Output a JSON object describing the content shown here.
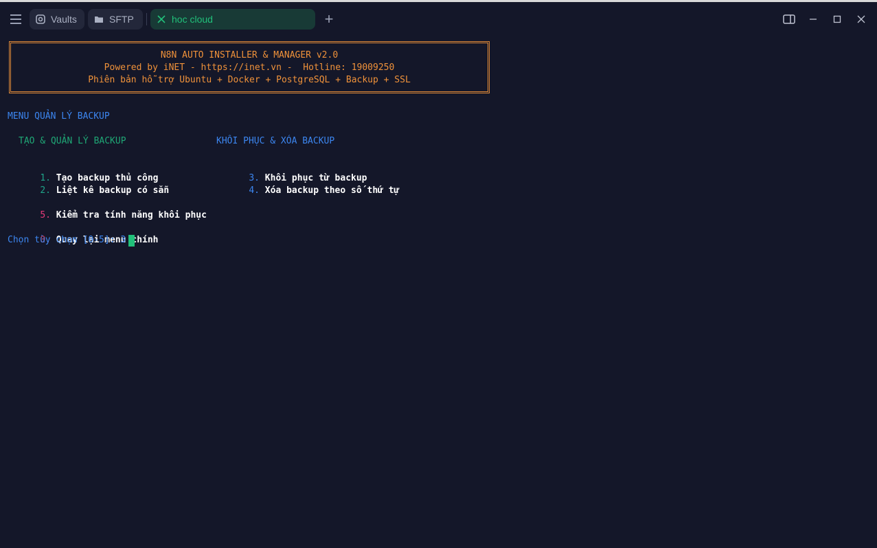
{
  "tabs": [
    {
      "label": "Vaults",
      "icon": "vault-icon"
    },
    {
      "label": "SFTP",
      "icon": "folder-icon"
    },
    {
      "label": "hoc cloud",
      "icon": "close-icon",
      "active": true
    }
  ],
  "banner": {
    "line1": "N8N AUTO INSTALLER & MANAGER v2.0",
    "line2": "Powered by iNET - https://inet.vn -  Hotline: 19009250",
    "line3": "Phiên bản hỗ trợ Ubuntu + Docker + PostgreSQL + Backup + SSL"
  },
  "menu": {
    "title": "MENU QUẢN LÝ BACKUP",
    "section_left": "TẠO & QUẢN LÝ BACKUP",
    "section_right": "KHÔI PHỤC & XÓA BACKUP",
    "options": [
      {
        "num": "1.",
        "label": "Tạo backup thủ công"
      },
      {
        "num": "2.",
        "label": "Liệt kê backup có sẵn"
      },
      {
        "num": "3.",
        "label": "Khôi phục từ backup"
      },
      {
        "num": "4.",
        "label": "Xóa backup theo số thứ tự"
      },
      {
        "num": "5.",
        "label": "Kiểm tra tính năng khôi phục"
      },
      {
        "num": "0.",
        "label": "Quay lại menu chính"
      }
    ],
    "prompt": "Chọn tùy chọn [0-5]: ",
    "input": "3"
  },
  "colors": {
    "background": "#141729",
    "banner": "#f0923a",
    "accent_green": "#21c07a",
    "menu_blue": "#3c86f0"
  }
}
